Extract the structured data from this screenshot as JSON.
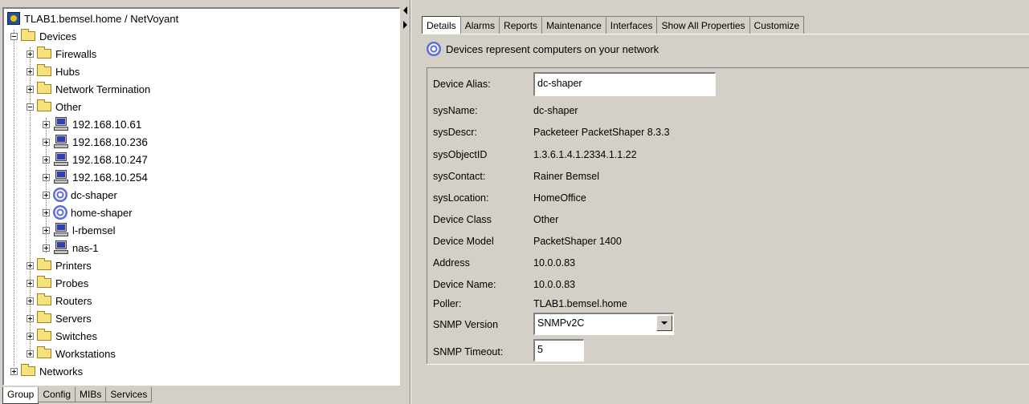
{
  "tree": {
    "root_label": "TLAB1.bemsel.home / NetVoyant",
    "devices_label": "Devices",
    "groups": [
      {
        "label": "Firewalls"
      },
      {
        "label": "Hubs"
      },
      {
        "label": "Network Termination"
      }
    ],
    "other_label": "Other",
    "other_children": [
      {
        "label": "192.168.10.61",
        "icon": "computer-icon"
      },
      {
        "label": "192.168.10.236",
        "icon": "computer-icon"
      },
      {
        "label": "192.168.10.247",
        "icon": "computer-icon"
      },
      {
        "label": "192.168.10.254",
        "icon": "computer-icon"
      },
      {
        "label": "dc-shaper",
        "icon": "swirl-icon"
      },
      {
        "label": "home-shaper",
        "icon": "swirl-icon"
      },
      {
        "label": "l-rbemsel",
        "icon": "computer-icon"
      },
      {
        "label": "nas-1",
        "icon": "computer-icon"
      }
    ],
    "groups_after": [
      {
        "label": "Printers"
      },
      {
        "label": "Probes"
      },
      {
        "label": "Routers"
      },
      {
        "label": "Servers"
      },
      {
        "label": "Switches"
      },
      {
        "label": "Workstations"
      }
    ],
    "networks_label": "Networks"
  },
  "left_tabs": [
    "Group",
    "Config",
    "MIBs",
    "Services"
  ],
  "tabs": [
    "Details",
    "Alarms",
    "Reports",
    "Maintenance",
    "Interfaces",
    "Show All Properties",
    "Customize"
  ],
  "header": {
    "text": "Devices represent computers on your network"
  },
  "details": {
    "device_alias": {
      "label": "Device Alias:",
      "value": "dc-shaper"
    },
    "props": [
      {
        "label": "sysName:",
        "value": "dc-shaper"
      },
      {
        "label": "sysDescr:",
        "value": "Packeteer PacketShaper 8.3.3"
      },
      {
        "label": "sysObjectID",
        "value": "1.3.6.1.4.1.2334.1.1.22"
      },
      {
        "label": "sysContact:",
        "value": "Rainer Bemsel"
      },
      {
        "label": "sysLocation:",
        "value": "HomeOffice"
      },
      {
        "label": "Device Class",
        "value": "Other"
      },
      {
        "label": "Device Model",
        "value": "PacketShaper 1400"
      },
      {
        "label": "Address",
        "value": "10.0.0.83"
      },
      {
        "label": "Device Name:",
        "value": "10.0.0.83"
      },
      {
        "label": "Poller:",
        "value": "TLAB1.bemsel.home"
      }
    ],
    "snmp_version": {
      "label": "SNMP Version",
      "value": "SNMPv2C"
    },
    "snmp_timeout": {
      "label": "SNMP Timeout:",
      "value": "5"
    }
  },
  "colors": {
    "background": "#d4d0c8",
    "folder": "#f6e27a",
    "swirl": "#5a6ad8"
  }
}
